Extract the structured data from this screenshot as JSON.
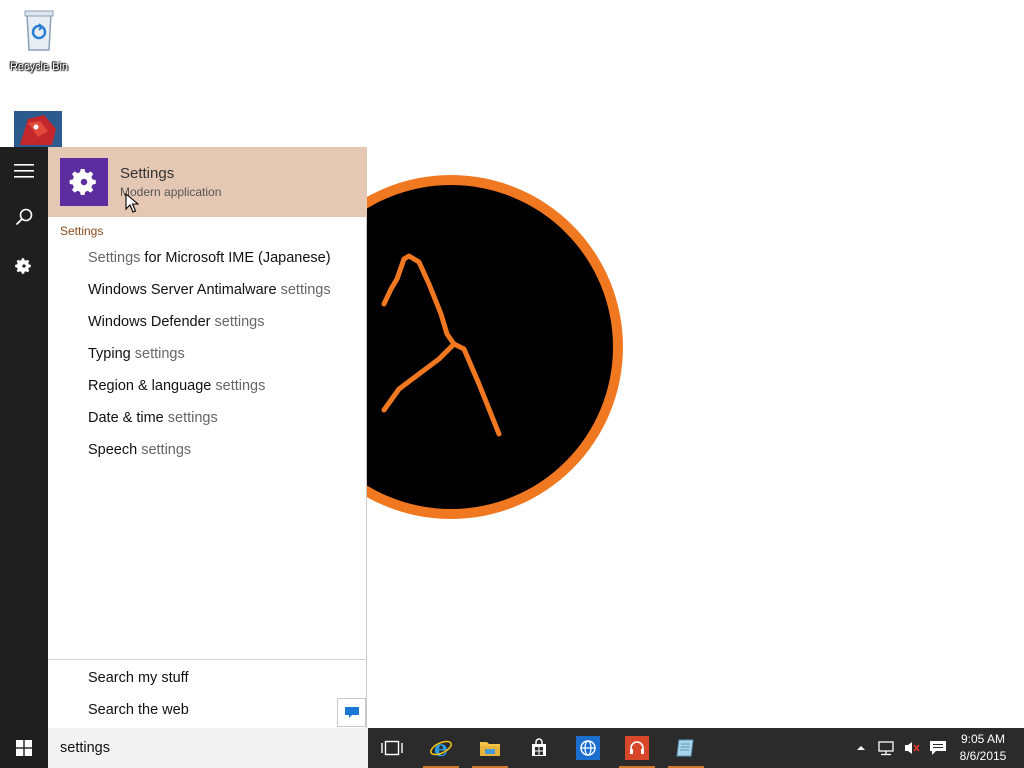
{
  "desktop": {
    "icons": [
      {
        "label": "Recycle Bin",
        "icon": "recycle-bin-icon"
      },
      {
        "label": "",
        "icon": "app-shortcut-icon"
      }
    ]
  },
  "rail": {
    "items": [
      {
        "icon": "hamburger-menu-icon"
      },
      {
        "icon": "search-icon"
      },
      {
        "icon": "gear-icon"
      }
    ]
  },
  "top_result": {
    "title": "Settings",
    "subtitle": "Modern application",
    "icon": "gear-icon"
  },
  "group_header": "Settings",
  "results": [
    {
      "main": "Settings",
      "suffix": " for Microsoft IME (Japanese)",
      "dim_first": true
    },
    {
      "main": "Windows Server Antimalware",
      "suffix": " settings",
      "dim_first": false
    },
    {
      "main": "Windows Defender",
      "suffix": " settings",
      "dim_first": false
    },
    {
      "main": "Typing",
      "suffix": " settings",
      "dim_first": false
    },
    {
      "main": "Region & language",
      "suffix": " settings",
      "dim_first": false
    },
    {
      "main": "Date & time",
      "suffix": " settings",
      "dim_first": false
    },
    {
      "main": "Speech",
      "suffix": " settings",
      "dim_first": false
    }
  ],
  "bottom": {
    "search_my_stuff": "Search my stuff",
    "search_the_web": "Search the web"
  },
  "taskbar": {
    "search_text": "settings",
    "apps": [
      {
        "icon": "task-view-icon"
      },
      {
        "icon": "internet-explorer-icon"
      },
      {
        "icon": "file-explorer-icon"
      },
      {
        "icon": "store-icon"
      },
      {
        "icon": "globe-app-icon"
      },
      {
        "icon": "headphones-app-icon"
      },
      {
        "icon": "notepad-app-icon"
      }
    ],
    "tray": {
      "time": "9:05 AM",
      "date": "8/6/2015"
    }
  },
  "colors": {
    "accent": "#d0792a",
    "tile": "#5b2d9e",
    "highlight": "#e5c8b4",
    "taskbar": "#2b2b2b",
    "rail": "#1f1f1f"
  }
}
